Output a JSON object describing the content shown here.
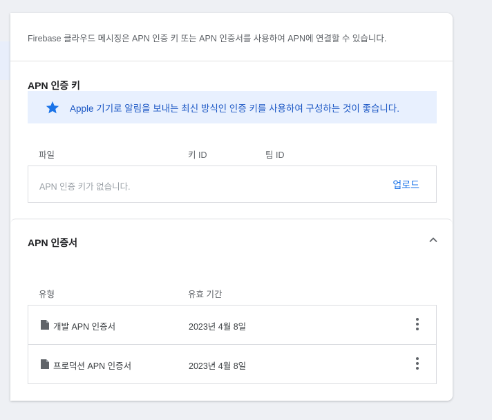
{
  "description": "Firebase 클라우드 메시징은 APN 인증 키 또는 APN 인증서를 사용하여 APN에 연결할 수 있습니다.",
  "auth_key": {
    "title": "APN 인증 키",
    "banner_text": "Apple 기기로 알림을 보내는 최신 방식인 인증 키를 사용하여 구성하는 것이 좋습니다.",
    "banner_icon": "star-icon",
    "columns": [
      "파일",
      "키 ID",
      "팀 ID"
    ],
    "empty_message": "APN 인증 키가 없습니다.",
    "upload_label": "업로드"
  },
  "certificates": {
    "title": "APN 인증서",
    "columns": [
      "유형",
      "유효 기간"
    ],
    "rows": [
      {
        "type": "개발 APN 인증서",
        "expiry": "2023년 4월 8일"
      },
      {
        "type": "프로덕션 APN 인증서",
        "expiry": "2023년 4월 8일"
      }
    ]
  },
  "colors": {
    "accent": "#1a73e8",
    "banner_bg": "#e8f0fe"
  }
}
